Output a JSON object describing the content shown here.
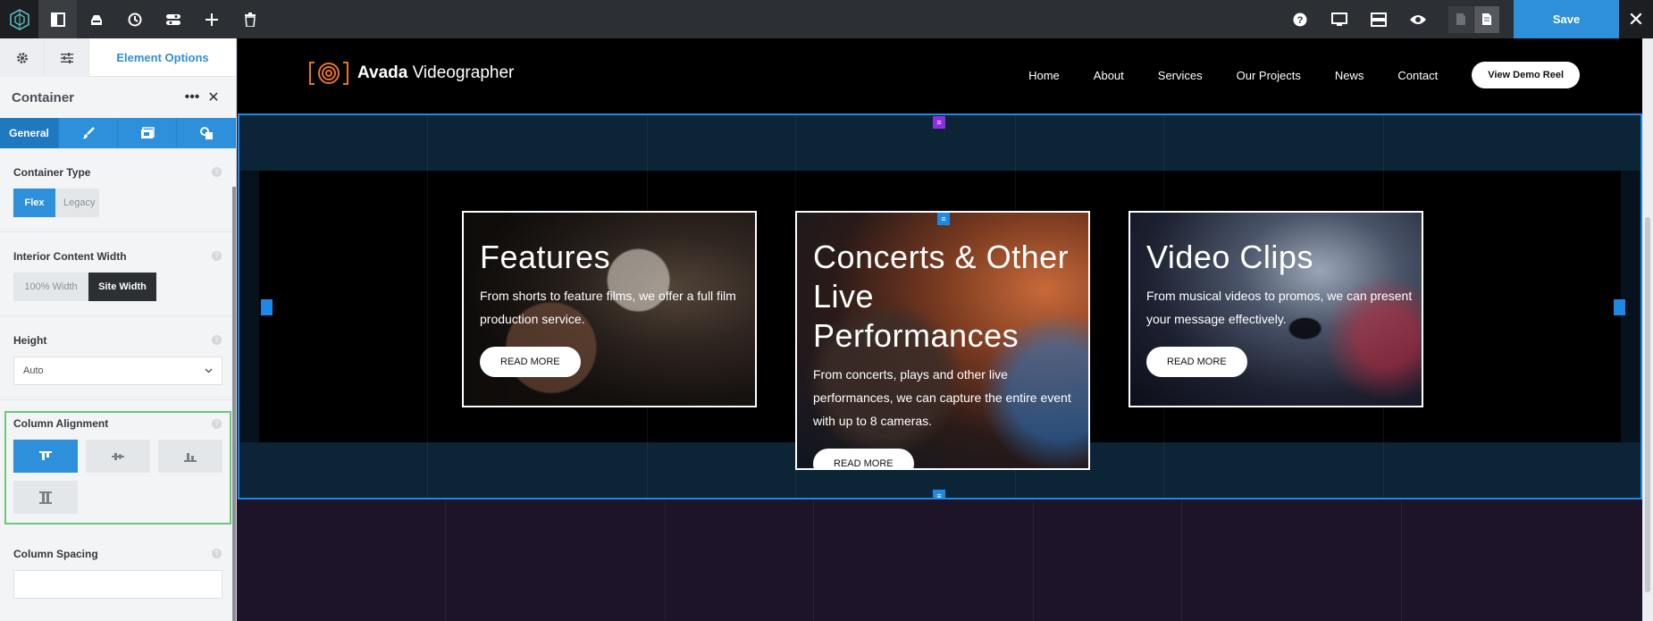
{
  "toolbar": {
    "save_label": "Save",
    "close_glyph": "✕"
  },
  "panel": {
    "tab_label": "Element Options",
    "title": "Container",
    "more_glyph": "•••",
    "close_glyph": "✕",
    "subtab_general": "General",
    "container_type": {
      "label": "Container Type",
      "options": [
        "Flex",
        "Legacy"
      ],
      "selected": "Flex"
    },
    "interior_width": {
      "label": "Interior Content Width",
      "options": [
        "100% Width",
        "Site Width"
      ],
      "selected": "Site Width"
    },
    "height": {
      "label": "Height",
      "value": "Auto"
    },
    "column_alignment": {
      "label": "Column Alignment",
      "options": [
        "top",
        "center",
        "bottom",
        "stretch"
      ],
      "selected": "top"
    },
    "column_spacing": {
      "label": "Column Spacing",
      "value": ""
    }
  },
  "site": {
    "brand_bold": "Avada",
    "brand_rest": " Videographer",
    "nav": [
      "Home",
      "About",
      "Services",
      "Our Projects",
      "News",
      "Contact"
    ],
    "cta": "View Demo Reel"
  },
  "cards": [
    {
      "title": "Features",
      "text": "From shorts to feature films, we offer a full film production service.",
      "button": "READ MORE"
    },
    {
      "title": "Concerts & Other Live Performances",
      "text": "From concerts, plays and other live performances, we can capture the entire event with up to 8 cameras.",
      "button": "READ MORE"
    },
    {
      "title": "Video Clips",
      "text": "From musical videos to promos, we can present your message effectively.",
      "button": "READ MORE"
    }
  ],
  "colors": {
    "accent": "#2e8fda",
    "brand_orange": "#e8742a",
    "selection_border": "#1e88e5",
    "highlight_green": "#6dc77a"
  }
}
